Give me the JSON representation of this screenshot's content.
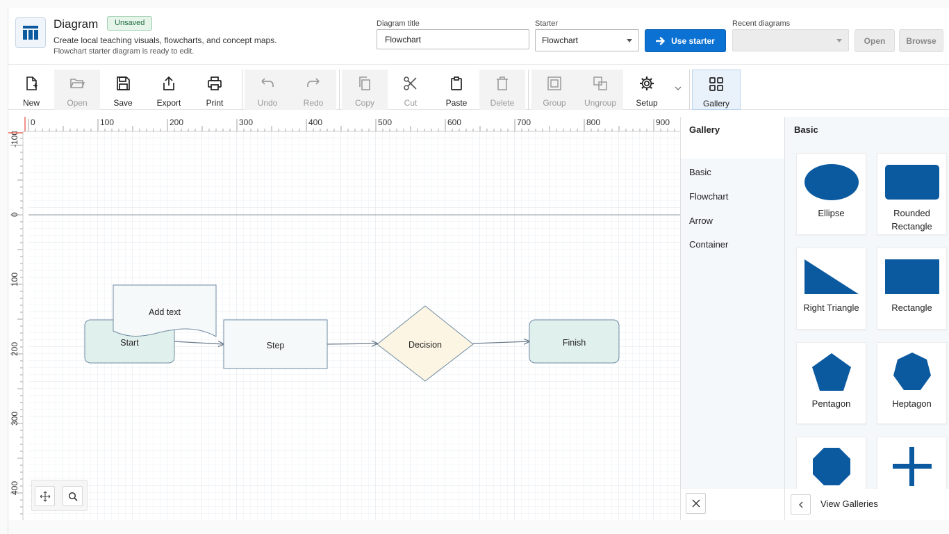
{
  "header": {
    "app_title": "Diagram",
    "badge": "Unsaved",
    "description": "Create local teaching visuals, flowcharts, and concept maps.",
    "status": "Flowchart starter diagram is ready to edit.",
    "diagram_title_label": "Diagram title",
    "diagram_title_value": "Flowchart",
    "starter_label": "Starter",
    "starter_value": "Flowchart",
    "use_starter_label": "Use starter",
    "recent_label": "Recent diagrams",
    "recent_value": "",
    "open_label": "Open",
    "browse_label": "Browse"
  },
  "toolbar": {
    "new": "New",
    "open": "Open",
    "save": "Save",
    "export": "Export",
    "print": "Print",
    "undo": "Undo",
    "redo": "Redo",
    "copy": "Copy",
    "cut": "Cut",
    "paste": "Paste",
    "delete": "Delete",
    "group": "Group",
    "ungroup": "Ungroup",
    "setup": "Setup",
    "gallery": "Gallery"
  },
  "ruler": {
    "x_labels": [
      "0",
      "100",
      "200",
      "300",
      "400",
      "500",
      "600",
      "700",
      "800",
      "900"
    ],
    "y_labels": [
      "-100",
      "0",
      "100",
      "200",
      "300",
      "400"
    ]
  },
  "diagram": {
    "nodes": {
      "start": "Start",
      "step": "Step",
      "decision": "Decision",
      "finish": "Finish",
      "note": "Add text"
    }
  },
  "gallery_nav": {
    "title": "Gallery",
    "items": [
      "Basic",
      "Flowchart",
      "Arrow",
      "Container"
    ]
  },
  "gallery_shapes": {
    "title": "Basic",
    "shapes": [
      "Ellipse",
      "Rounded Rectangle",
      "Right Triangle",
      "Rectangle",
      "Pentagon",
      "Heptagon"
    ],
    "view_galleries": "View Galleries"
  },
  "colors": {
    "accent": "#0b72d4",
    "shape_fill": "#0b5aa0",
    "start_fill": "#e0f0ec",
    "decision_fill": "#fdf5e3",
    "step_fill": "#f6f9fa"
  }
}
